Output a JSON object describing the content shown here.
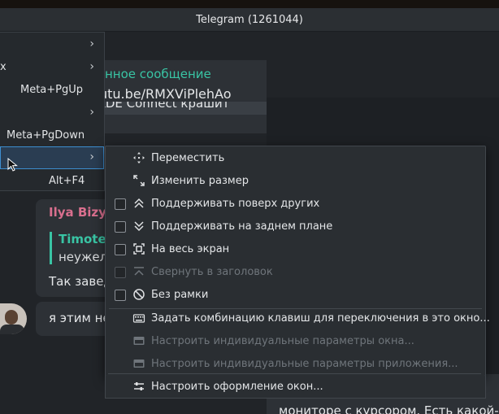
{
  "window": {
    "title": "Telegram (1261044)"
  },
  "chat": {
    "forwarded_label": "нное сообщение",
    "forwarded_link": "utu.be/RMXViPlehAo",
    "preview_strip": "KDE Connect крашит",
    "ilya_message": {
      "author": "Ilya Bizya",
      "quote_author": "Timotе",
      "quote_text": "неужел",
      "body": "Так завед"
    },
    "my_message": {
      "body": "я этим не"
    },
    "bottom_bubble": "мониторе с курсором. Есть какой-т"
  },
  "parent_menu": {
    "items": [
      {
        "label": "",
        "has_submenu": true
      },
      {
        "label": "x",
        "has_submenu": true
      },
      {
        "label": "Meta+PgUp",
        "has_submenu": false
      },
      {
        "label": "",
        "has_submenu": true
      },
      {
        "label": "Meta+PgDown",
        "has_submenu": false
      },
      {
        "label": "",
        "has_submenu": true,
        "active": true
      },
      {
        "label": "Alt+F4",
        "has_submenu": false
      }
    ]
  },
  "submenu": {
    "items": [
      {
        "label": "Переместить",
        "icon": "move-icon",
        "checkbox": false,
        "enabled": true
      },
      {
        "label": "Изменить размер",
        "icon": "resize-icon",
        "checkbox": false,
        "enabled": true
      },
      {
        "label": "Поддерживать поверх других",
        "icon": "keep-above-icon",
        "checkbox": true,
        "checked": false,
        "enabled": true
      },
      {
        "label": "Поддерживать на заднем плане",
        "icon": "keep-below-icon",
        "checkbox": true,
        "checked": false,
        "enabled": true
      },
      {
        "label": "На весь экран",
        "icon": "fullscreen-icon",
        "checkbox": true,
        "checked": false,
        "enabled": true
      },
      {
        "label": "Свернуть в заголовок",
        "icon": "shade-icon",
        "checkbox": true,
        "checked": false,
        "enabled": false
      },
      {
        "label": "Без рамки",
        "icon": "no-border-icon",
        "checkbox": true,
        "checked": false,
        "enabled": true
      },
      {
        "label": "Задать комбинацию клавиш для переключения в это окно...",
        "icon": "keyboard-icon",
        "checkbox": false,
        "enabled": true
      },
      {
        "label": "Настроить индивидуальные параметры окна...",
        "icon": "window-settings-icon",
        "checkbox": false,
        "enabled": false
      },
      {
        "label": "Настроить индивидуальные параметры приложения...",
        "icon": "app-settings-icon",
        "checkbox": false,
        "enabled": false
      },
      {
        "label": "Настроить оформление окон...",
        "icon": "configure-icon",
        "checkbox": false,
        "enabled": true
      }
    ]
  },
  "colors": {
    "accent": "#3d8ed0",
    "author_pink": "#d96f8e",
    "quote_teal": "#39c4a4"
  }
}
